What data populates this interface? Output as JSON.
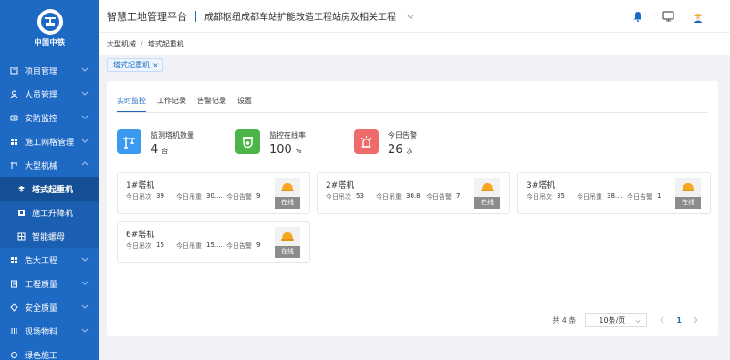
{
  "brand": {
    "logo_text": "中国中铁"
  },
  "sidebar": {
    "items": [
      {
        "label": "项目管理",
        "icon": "project-icon"
      },
      {
        "label": "人员管理",
        "icon": "people-icon"
      },
      {
        "label": "安防监控",
        "icon": "camera-icon"
      },
      {
        "label": "施工网格管理",
        "icon": "grid-icon"
      },
      {
        "label": "大型机械",
        "icon": "machinery-icon",
        "expanded": true
      }
    ],
    "subitems": [
      {
        "label": "塔式起重机",
        "icon": "crane-icon",
        "active": true
      },
      {
        "label": "施工升降机",
        "icon": "elevator-icon"
      },
      {
        "label": "智能螺母",
        "icon": "nut-icon"
      }
    ],
    "items_after": [
      {
        "label": "危大工程",
        "icon": "danger-icon"
      },
      {
        "label": "工程质量",
        "icon": "quality-icon"
      },
      {
        "label": "安全质量",
        "icon": "safety-icon"
      },
      {
        "label": "现场物料",
        "icon": "material-icon"
      },
      {
        "label": "绿色施工",
        "icon": "green-icon"
      }
    ]
  },
  "header": {
    "platform_title": "智慧工地管理平台",
    "project_name": "成都枢纽成都车站扩能改造工程站房及相关工程"
  },
  "breadcrumb": {
    "parent": "大型机械",
    "separator": "/",
    "current": "塔式起重机"
  },
  "tags": [
    {
      "label": "塔式起重机"
    }
  ],
  "tabs": [
    {
      "label": "实时监控",
      "active": true
    },
    {
      "label": "工作记录"
    },
    {
      "label": "告警记录"
    },
    {
      "label": "设置"
    }
  ],
  "stats": [
    {
      "label": "监测塔机数量",
      "value": "4",
      "unit": "台",
      "color": "#3b99f0",
      "icon": "crane-icon"
    },
    {
      "label": "监控在线率",
      "value": "100",
      "unit": "%",
      "color": "#4cb548",
      "icon": "monitor-icon"
    },
    {
      "label": "今日告警",
      "value": "26",
      "unit": "次",
      "color": "#f06a6a",
      "icon": "alarm-icon"
    }
  ],
  "metric_labels": {
    "lifts": "今日吊次",
    "weight": "今日吊重",
    "alarms": "今日告警"
  },
  "cranes": [
    {
      "name": "1#塔机",
      "lifts": "39",
      "weight": "30....",
      "alarms": "9",
      "status": "在线"
    },
    {
      "name": "2#塔机",
      "lifts": "53",
      "weight": "30.8",
      "alarms": "7",
      "status": "在线"
    },
    {
      "name": "3#塔机",
      "lifts": "35",
      "weight": "38....",
      "alarms": "1",
      "status": "在线"
    },
    {
      "name": "6#塔机",
      "lifts": "15",
      "weight": "15....",
      "alarms": "9",
      "status": "在线"
    }
  ],
  "pagination": {
    "total": "共 4 条",
    "page_size": "10条/页",
    "current_page": "1"
  },
  "colors": {
    "primary": "#1e69c4",
    "status_bg": "#8c8c8c",
    "helmet": "#f5a623"
  }
}
